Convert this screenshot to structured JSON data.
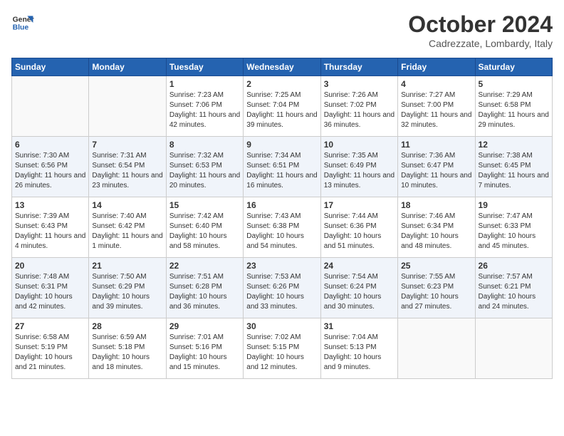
{
  "header": {
    "logo_line1": "General",
    "logo_line2": "Blue",
    "month": "October 2024",
    "location": "Cadrezzate, Lombardy, Italy"
  },
  "weekdays": [
    "Sunday",
    "Monday",
    "Tuesday",
    "Wednesday",
    "Thursday",
    "Friday",
    "Saturday"
  ],
  "weeks": [
    [
      {
        "day": "",
        "info": ""
      },
      {
        "day": "",
        "info": ""
      },
      {
        "day": "1",
        "info": "Sunrise: 7:23 AM\nSunset: 7:06 PM\nDaylight: 11 hours\nand 42 minutes."
      },
      {
        "day": "2",
        "info": "Sunrise: 7:25 AM\nSunset: 7:04 PM\nDaylight: 11 hours\nand 39 minutes."
      },
      {
        "day": "3",
        "info": "Sunrise: 7:26 AM\nSunset: 7:02 PM\nDaylight: 11 hours\nand 36 minutes."
      },
      {
        "day": "4",
        "info": "Sunrise: 7:27 AM\nSunset: 7:00 PM\nDaylight: 11 hours\nand 32 minutes."
      },
      {
        "day": "5",
        "info": "Sunrise: 7:29 AM\nSunset: 6:58 PM\nDaylight: 11 hours\nand 29 minutes."
      }
    ],
    [
      {
        "day": "6",
        "info": "Sunrise: 7:30 AM\nSunset: 6:56 PM\nDaylight: 11 hours\nand 26 minutes."
      },
      {
        "day": "7",
        "info": "Sunrise: 7:31 AM\nSunset: 6:54 PM\nDaylight: 11 hours\nand 23 minutes."
      },
      {
        "day": "8",
        "info": "Sunrise: 7:32 AM\nSunset: 6:53 PM\nDaylight: 11 hours\nand 20 minutes."
      },
      {
        "day": "9",
        "info": "Sunrise: 7:34 AM\nSunset: 6:51 PM\nDaylight: 11 hours\nand 16 minutes."
      },
      {
        "day": "10",
        "info": "Sunrise: 7:35 AM\nSunset: 6:49 PM\nDaylight: 11 hours\nand 13 minutes."
      },
      {
        "day": "11",
        "info": "Sunrise: 7:36 AM\nSunset: 6:47 PM\nDaylight: 11 hours\nand 10 minutes."
      },
      {
        "day": "12",
        "info": "Sunrise: 7:38 AM\nSunset: 6:45 PM\nDaylight: 11 hours\nand 7 minutes."
      }
    ],
    [
      {
        "day": "13",
        "info": "Sunrise: 7:39 AM\nSunset: 6:43 PM\nDaylight: 11 hours\nand 4 minutes."
      },
      {
        "day": "14",
        "info": "Sunrise: 7:40 AM\nSunset: 6:42 PM\nDaylight: 11 hours\nand 1 minute."
      },
      {
        "day": "15",
        "info": "Sunrise: 7:42 AM\nSunset: 6:40 PM\nDaylight: 10 hours\nand 58 minutes."
      },
      {
        "day": "16",
        "info": "Sunrise: 7:43 AM\nSunset: 6:38 PM\nDaylight: 10 hours\nand 54 minutes."
      },
      {
        "day": "17",
        "info": "Sunrise: 7:44 AM\nSunset: 6:36 PM\nDaylight: 10 hours\nand 51 minutes."
      },
      {
        "day": "18",
        "info": "Sunrise: 7:46 AM\nSunset: 6:34 PM\nDaylight: 10 hours\nand 48 minutes."
      },
      {
        "day": "19",
        "info": "Sunrise: 7:47 AM\nSunset: 6:33 PM\nDaylight: 10 hours\nand 45 minutes."
      }
    ],
    [
      {
        "day": "20",
        "info": "Sunrise: 7:48 AM\nSunset: 6:31 PM\nDaylight: 10 hours\nand 42 minutes."
      },
      {
        "day": "21",
        "info": "Sunrise: 7:50 AM\nSunset: 6:29 PM\nDaylight: 10 hours\nand 39 minutes."
      },
      {
        "day": "22",
        "info": "Sunrise: 7:51 AM\nSunset: 6:28 PM\nDaylight: 10 hours\nand 36 minutes."
      },
      {
        "day": "23",
        "info": "Sunrise: 7:53 AM\nSunset: 6:26 PM\nDaylight: 10 hours\nand 33 minutes."
      },
      {
        "day": "24",
        "info": "Sunrise: 7:54 AM\nSunset: 6:24 PM\nDaylight: 10 hours\nand 30 minutes."
      },
      {
        "day": "25",
        "info": "Sunrise: 7:55 AM\nSunset: 6:23 PM\nDaylight: 10 hours\nand 27 minutes."
      },
      {
        "day": "26",
        "info": "Sunrise: 7:57 AM\nSunset: 6:21 PM\nDaylight: 10 hours\nand 24 minutes."
      }
    ],
    [
      {
        "day": "27",
        "info": "Sunrise: 6:58 AM\nSunset: 5:19 PM\nDaylight: 10 hours\nand 21 minutes."
      },
      {
        "day": "28",
        "info": "Sunrise: 6:59 AM\nSunset: 5:18 PM\nDaylight: 10 hours\nand 18 minutes."
      },
      {
        "day": "29",
        "info": "Sunrise: 7:01 AM\nSunset: 5:16 PM\nDaylight: 10 hours\nand 15 minutes."
      },
      {
        "day": "30",
        "info": "Sunrise: 7:02 AM\nSunset: 5:15 PM\nDaylight: 10 hours\nand 12 minutes."
      },
      {
        "day": "31",
        "info": "Sunrise: 7:04 AM\nSunset: 5:13 PM\nDaylight: 10 hours\nand 9 minutes."
      },
      {
        "day": "",
        "info": ""
      },
      {
        "day": "",
        "info": ""
      }
    ]
  ]
}
